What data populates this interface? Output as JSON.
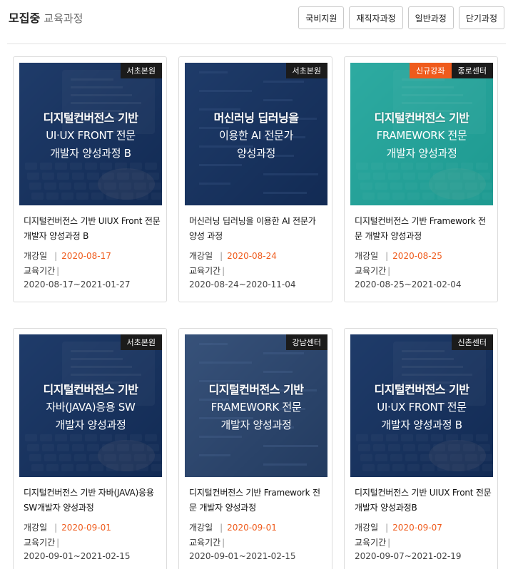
{
  "header": {
    "title_strong": "모집중",
    "title_light": "교육과정",
    "filters": [
      "국비지원",
      "재직자과정",
      "일반과정",
      "단기과정"
    ]
  },
  "labels": {
    "start": "개강일",
    "period": "교육기간",
    "sep": "|"
  },
  "colors": {
    "accent": "#ef5b1c",
    "badge_dark": "#1b1b1b"
  },
  "cards": [
    {
      "badges": [
        "서초본원"
      ],
      "overlay": [
        "디지털컨버전스 기반",
        "UI·UX FRONT 전문",
        "개발자 양성과정 B"
      ],
      "title": "디지털컨버전스 기반 UIUX Front 전문 개발자 양성과정 B",
      "start_date": "2020-08-17",
      "period": "2020-08-17~2021-01-27",
      "theme": "navy"
    },
    {
      "badges": [
        "서초본원"
      ],
      "overlay": [
        "머신러닝 딥러닝을",
        "이용한 AI 전문가",
        "양성과정"
      ],
      "title": "머신러닝 딥러닝을 이용한 AI 전문가 양성 과정",
      "start_date": "2020-08-24",
      "period": "2020-08-24~2020-11-04",
      "theme": "navy"
    },
    {
      "badges": [
        "신규강좌",
        "종로센터"
      ],
      "overlay": [
        "디지털컨버전스 기반",
        "FRAMEWORK 전문",
        "개발자 양성과정"
      ],
      "title": "디지털컨버전스 기반 Framework 전문 개발자 양성과정",
      "start_date": "2020-08-25",
      "period": "2020-08-25~2021-02-04",
      "theme": "teal"
    },
    {
      "badges": [
        "서초본원"
      ],
      "overlay": [
        "디지털컨버전스 기반",
        "자바(JAVA)응용 SW",
        "개발자 양성과정"
      ],
      "title": "디지털컨버전스 기반 자바(JAVA)응용SW개발자 양성과정",
      "start_date": "2020-09-01",
      "period": "2020-09-01~2021-02-15",
      "theme": "navy"
    },
    {
      "badges": [
        "강남센터"
      ],
      "overlay": [
        "디지털컨버전스 기반",
        "FRAMEWORK 전문",
        "개발자 양성과정"
      ],
      "title": "디지털컨버전스 기반 Framework 전문 개발자 양성과정",
      "start_date": "2020-09-01",
      "period": "2020-09-01~2021-02-15",
      "theme": "slate"
    },
    {
      "badges": [
        "신촌센터"
      ],
      "overlay": [
        "디지털컨버전스 기반",
        "UI·UX FRONT 전문",
        "개발자 양성과정 B"
      ],
      "title": "디지털컨버전스 기반 UIUX Front 전문 개발자 양성과정B",
      "start_date": "2020-09-07",
      "period": "2020-09-07~2021-02-19",
      "theme": "navy"
    }
  ]
}
